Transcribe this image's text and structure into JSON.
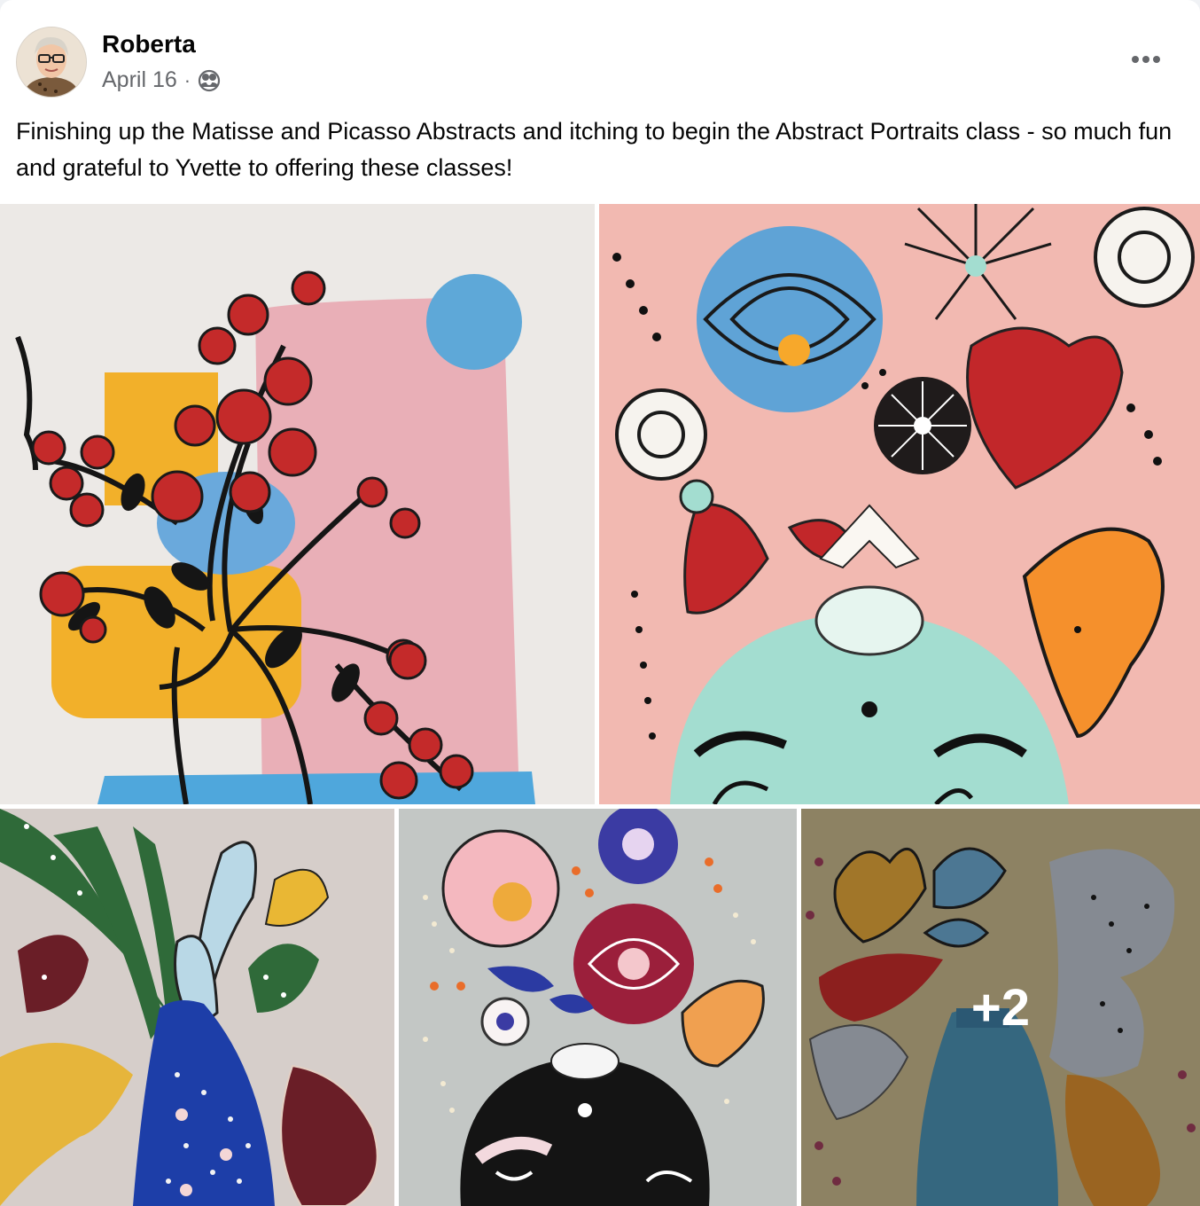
{
  "post": {
    "author": "Roberta",
    "date": "April 16",
    "separator": "·",
    "audience_icon": "friends-audience-icon",
    "more_icon": "more-options-icon",
    "caption": "Finishing up the Matisse and Picasso Abstracts and itching to begin the Abstract Portraits class - so much fun and grateful to Yvette to offering these classes!"
  },
  "gallery": {
    "photo_count_visible": 5,
    "more_photos_label": "+2",
    "photos": [
      {
        "subject": "red roses in a vase with yellow, pink and blue shapes"
      },
      {
        "subject": "abstract portrait with flowers on a pink background"
      },
      {
        "subject": "vase with leaves and yellow and maroon shapes"
      },
      {
        "subject": "flowers on a black head portrait"
      },
      {
        "subject": "leaves and flowers in a blue vase on olive background"
      }
    ]
  }
}
